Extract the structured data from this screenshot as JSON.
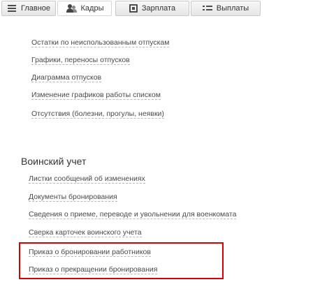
{
  "tabs": [
    {
      "label": "Главное",
      "icon": "menu-icon",
      "active": false
    },
    {
      "label": "Кадры",
      "icon": "people-icon",
      "active": true
    },
    {
      "label": "Зарплата",
      "icon": "sheet-icon",
      "active": false
    },
    {
      "label": "Выплаты",
      "icon": "list-icon",
      "active": false
    }
  ],
  "top_links": [
    "Остатки по неиспользованным отпускам",
    "Графики, переносы отпусков",
    "Диаграмма отпусков",
    "Изменение графиков работы списком",
    "Отсутствия (болезни, прогулы, неявки)"
  ],
  "military_section": {
    "heading": "Воинский учет",
    "links": [
      "Листки сообщений об изменениях",
      "Документы бронирования",
      "Сведения о приеме, переводе и увольнении для военкомата",
      "Сверка карточек воинского учета"
    ],
    "highlighted_links": [
      "Приказ о бронировании работников",
      "Приказ о прекращении бронирования"
    ],
    "highlight_color": "#d40000"
  }
}
